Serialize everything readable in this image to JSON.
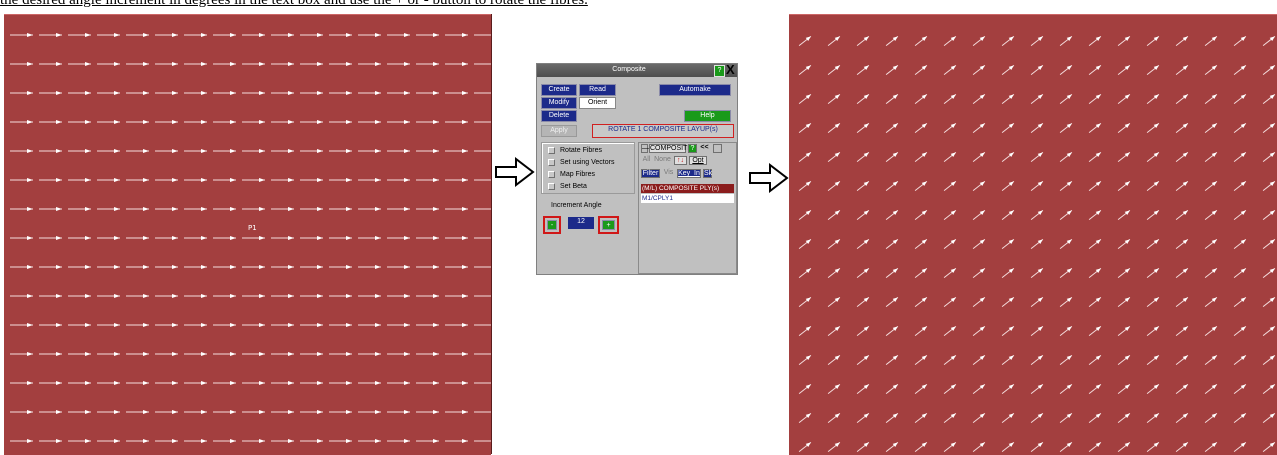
{
  "header": {
    "caption": "the desired angle increment in degrees in the text box and use the + or - button to rotate the fibres."
  },
  "left_panel": {
    "label": "P1",
    "fibre_direction": "horizontal",
    "background": "#a33f3f"
  },
  "right_panel": {
    "fibre_direction": "rotated",
    "background": "#a33f3f"
  },
  "window": {
    "title": "Composite",
    "help_icon": "?",
    "close_icon": "X",
    "buttons": {
      "create": "Create",
      "read": "Read",
      "automake": "Automake",
      "modify": "Modify",
      "orient": "Orient",
      "delete": "Delete",
      "help": "Help",
      "apply": "Apply"
    },
    "status_label": "ROTATE 1 COMPOSITE LAYUP(s)",
    "options": [
      "Rotate Fibres",
      "Set using Vectors",
      "Map Fibres",
      "Set Beta"
    ],
    "increment_label": "Increment Angle",
    "increment_value": "12",
    "minus_label": "-",
    "plus_label": "+"
  },
  "selector": {
    "dash": "—",
    "title": "COMPOSITE",
    "help": "?",
    "collapse": "<<",
    "all": "All",
    "none": "None",
    "sort_icon": "↑↓",
    "opt": "Opt",
    "filter": "Filter",
    "vis": "Vis",
    "key_in": "Key_In",
    "sk": "Sk",
    "list_header": "(M/L) COMPOSITE PLY(s)",
    "items": [
      "M1/CPLY1"
    ]
  },
  "colors": {
    "panel": "#a33f3f",
    "accent_blue": "#1c2a8a",
    "green": "#1a9a1a",
    "highlight_red": "#d01818"
  }
}
